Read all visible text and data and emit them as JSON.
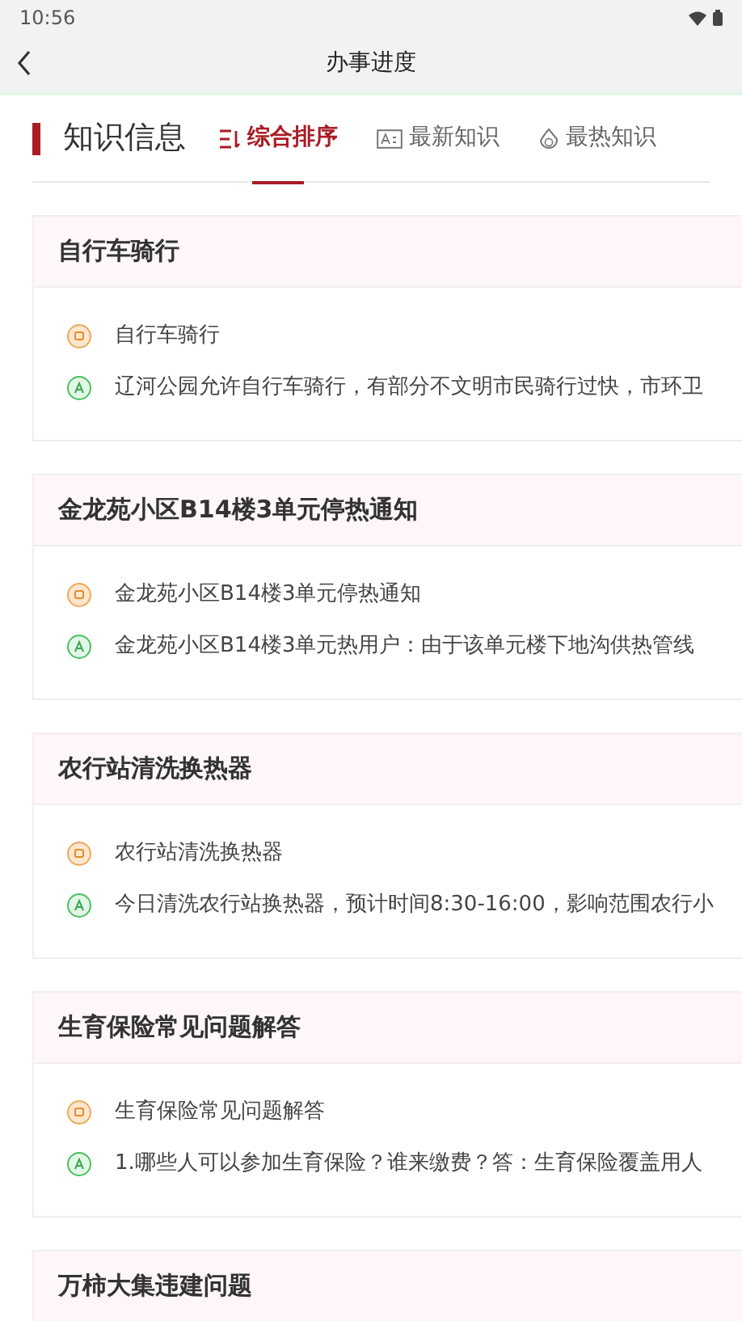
{
  "status_bar": {
    "time": "10:56"
  },
  "header": {
    "title": "办事进度"
  },
  "section": {
    "title": "知识信息"
  },
  "tabs": [
    {
      "label": "综合排序",
      "kind": "sort",
      "selected": true
    },
    {
      "label": "最新知识",
      "kind": "new",
      "selected": false
    },
    {
      "label": "最热知识",
      "kind": "hot",
      "selected": false
    }
  ],
  "cards": [
    {
      "title": "自行车骑行",
      "question": "自行车骑行",
      "answer": "辽河公园允许自行车骑行，有部分不文明市民骑行过快，市环卫"
    },
    {
      "title": "金龙苑小区B14楼3单元停热通知",
      "question": "金龙苑小区B14楼3单元停热通知",
      "answer": "金龙苑小区B14楼3单元热用户：由于该单元楼下地沟供热管线"
    },
    {
      "title": "农行站清洗换热器",
      "question": "农行站清洗换热器",
      "answer": "今日清洗农行站换热器，预计时间8:30-16:00，影响范围农行小"
    },
    {
      "title": "生育保险常见问题解答",
      "question": "生育保险常见问题解答",
      "answer": "1.哪些人可以参加生育保险？谁来缴费？答：生育保险覆盖用人"
    },
    {
      "title": "万柿大集违建问题"
    }
  ]
}
